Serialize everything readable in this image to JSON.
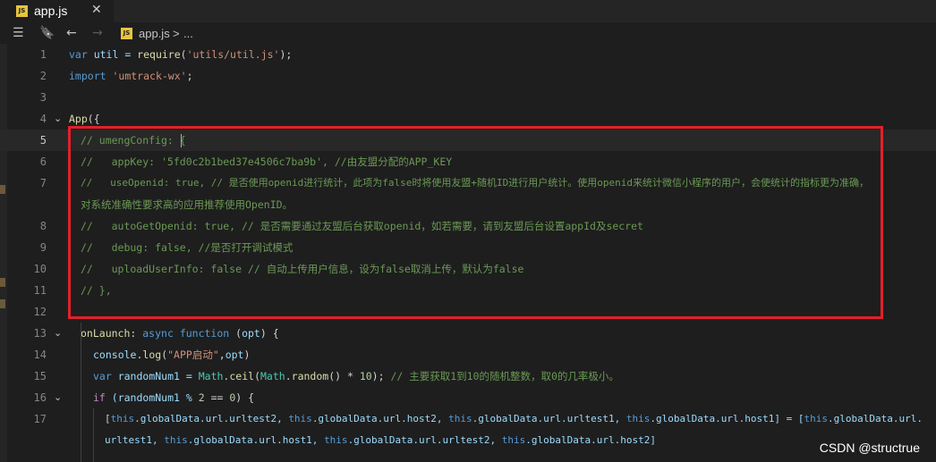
{
  "tab": {
    "icon": "JS",
    "title": "app.js",
    "close": "✕"
  },
  "toolbar": {
    "list": "☰",
    "bookmark": "🔖",
    "back": "←",
    "forward": "→"
  },
  "breadcrumb": {
    "icon": "JS",
    "file": "app.js",
    "sep": ">",
    "more": "..."
  },
  "lines": {
    "l1": {
      "n": "1",
      "a": "var",
      "b": " util = ",
      "c": "require",
      "d": "(",
      "e": "'utils/util.js'",
      "f": ");"
    },
    "l2": {
      "n": "2",
      "a": "import",
      "b": " ",
      "c": "'umtrack-wx'",
      "d": ";"
    },
    "l3": {
      "n": "3"
    },
    "l4": {
      "n": "4",
      "a": "App",
      "b": "({"
    },
    "l5": {
      "n": "5",
      "a": "// umengConfig: {"
    },
    "l6": {
      "n": "6",
      "a": "//   appKey: '5fd0c2b1bed37e4506c7ba9b', //由友盟分配的APP_KEY"
    },
    "l7": {
      "n": "7",
      "a": "//   useOpenid: true, // 是否使用openid进行统计，此项为false时将使用友盟+随机ID进行用户统计。使用openid来统计微信小程序的用户，会使统计的指标更为准确，",
      "b": "对系统准确性要求高的应用推荐使用OpenID。"
    },
    "l8": {
      "n": "8",
      "a": "//   autoGetOpenid: true, // 是否需要通过友盟后台获取openid，如若需要，请到友盟后台设置appId及secret"
    },
    "l9": {
      "n": "9",
      "a": "//   debug: false, //是否打开调试模式"
    },
    "l10": {
      "n": "10",
      "a": "//   uploadUserInfo: false // 自动上传用户信息，设为false取消上传，默认为false"
    },
    "l11": {
      "n": "11",
      "a": "// },"
    },
    "l12": {
      "n": "12"
    },
    "l13": {
      "n": "13",
      "a": "onLaunch",
      "b": ": ",
      "c": "async",
      "d": " ",
      "e": "function",
      "f": " (",
      "g": "opt",
      "h": ") {"
    },
    "l14": {
      "n": "14",
      "a": "console",
      "b": ".",
      "c": "log",
      "d": "(",
      "e": "\"APP启动\"",
      "f": ",",
      "g": "opt",
      "h": ")"
    },
    "l15": {
      "n": "15",
      "a": "var",
      "b": " randomNum1 = ",
      "c": "Math",
      "d": ".",
      "e": "ceil",
      "f": "(",
      "g": "Math",
      "h": ".",
      "i": "random",
      "j": "() * ",
      "k": "10",
      "l": "); ",
      "m": "// 主要获取1到10的随机整数，取0的几率极小。"
    },
    "l16": {
      "n": "16",
      "a": "if",
      "b": " (randomNum1 % ",
      "c": "2",
      "d": " == ",
      "e": "0",
      "f": ") {"
    },
    "l17": {
      "n": "17",
      "a": "[",
      "b": "this",
      "c": ".globalData.url.urltest2, ",
      "d": "this",
      "e": ".globalData.url.host2, ",
      "f": "this",
      "g": ".globalData.url.urltest1, ",
      "h": "this",
      "i": ".globalData.url.host1] = [",
      "j": "this",
      "k": ".globalData.url.",
      "w1": "urltest1, ",
      "w2": "this",
      "w3": ".globalData.url.host1, ",
      "w4": "this",
      "w5": ".globalData.url.urltest2, ",
      "w6": "this",
      "w7": ".globalData.url.host2]"
    }
  },
  "watermark": "CSDN @structrue"
}
